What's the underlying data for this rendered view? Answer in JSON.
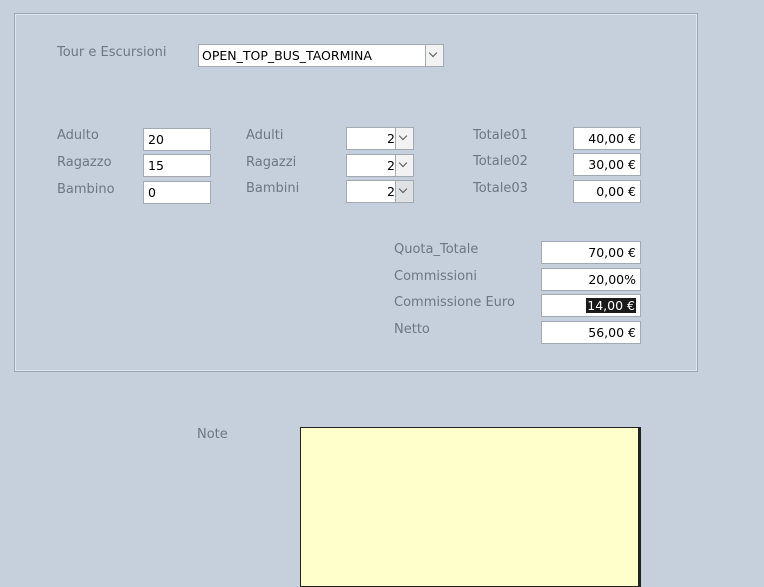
{
  "tour": {
    "label": "Tour e Escursioni",
    "value": "OPEN_TOP_BUS_TAORMINA"
  },
  "prices": [
    {
      "label": "Adulto",
      "value": "20"
    },
    {
      "label": "Ragazzo",
      "value": "15"
    },
    {
      "label": "Bambino",
      "value": "0"
    }
  ],
  "counts": [
    {
      "label": "Adulti",
      "value": "2"
    },
    {
      "label": "Ragazzi",
      "value": "2"
    },
    {
      "label": "Bambini",
      "value": "2"
    }
  ],
  "totals": [
    {
      "label": "Totale01",
      "value": "40,00 €"
    },
    {
      "label": "Totale02",
      "value": "30,00 €"
    },
    {
      "label": "Totale03",
      "value": "0,00 €"
    }
  ],
  "summary": {
    "quota_totale": {
      "label": "Quota_Totale",
      "value": "70,00 €"
    },
    "commissioni": {
      "label": "Commissioni",
      "value": "20,00%"
    },
    "commissione_euro": {
      "label": "Commissione Euro",
      "value": "14,00 €"
    },
    "netto": {
      "label": "Netto",
      "value": "56,00 €"
    }
  },
  "note": {
    "label": "Note",
    "value": ""
  },
  "colors": {
    "background": "#c5d0dc",
    "note_fill": "#ffffcc",
    "label_text": "#6d7782"
  },
  "icons": {
    "dropdown": "chevron-down-icon"
  }
}
